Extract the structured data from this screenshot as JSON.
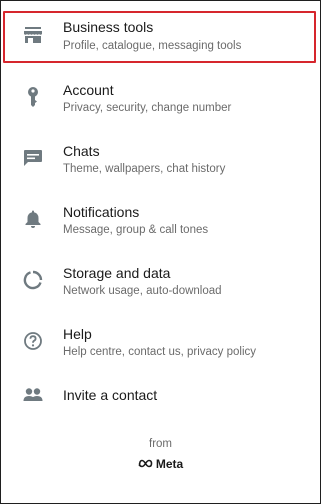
{
  "settings": {
    "items": [
      {
        "key": "business-tools",
        "title": "Business tools",
        "subtitle": "Profile, catalogue, messaging tools",
        "icon": "store-icon",
        "highlighted": true
      },
      {
        "key": "account",
        "title": "Account",
        "subtitle": "Privacy, security, change number",
        "icon": "key-icon"
      },
      {
        "key": "chats",
        "title": "Chats",
        "subtitle": "Theme, wallpapers, chat history",
        "icon": "chat-icon"
      },
      {
        "key": "notifications",
        "title": "Notifications",
        "subtitle": "Message, group & call tones",
        "icon": "bell-icon"
      },
      {
        "key": "storage",
        "title": "Storage and data",
        "subtitle": "Network usage, auto-download",
        "icon": "data-usage-icon"
      },
      {
        "key": "help",
        "title": "Help",
        "subtitle": "Help centre, contact us, privacy policy",
        "icon": "help-icon"
      },
      {
        "key": "invite",
        "title": "Invite a contact",
        "icon": "people-icon"
      }
    ]
  },
  "footer": {
    "from": "from",
    "brand": "Meta"
  },
  "colors": {
    "icon": "#6f7a80",
    "highlight_border": "#d6262d",
    "text": "#1a1a1a",
    "subtext": "#6b6b6b"
  }
}
